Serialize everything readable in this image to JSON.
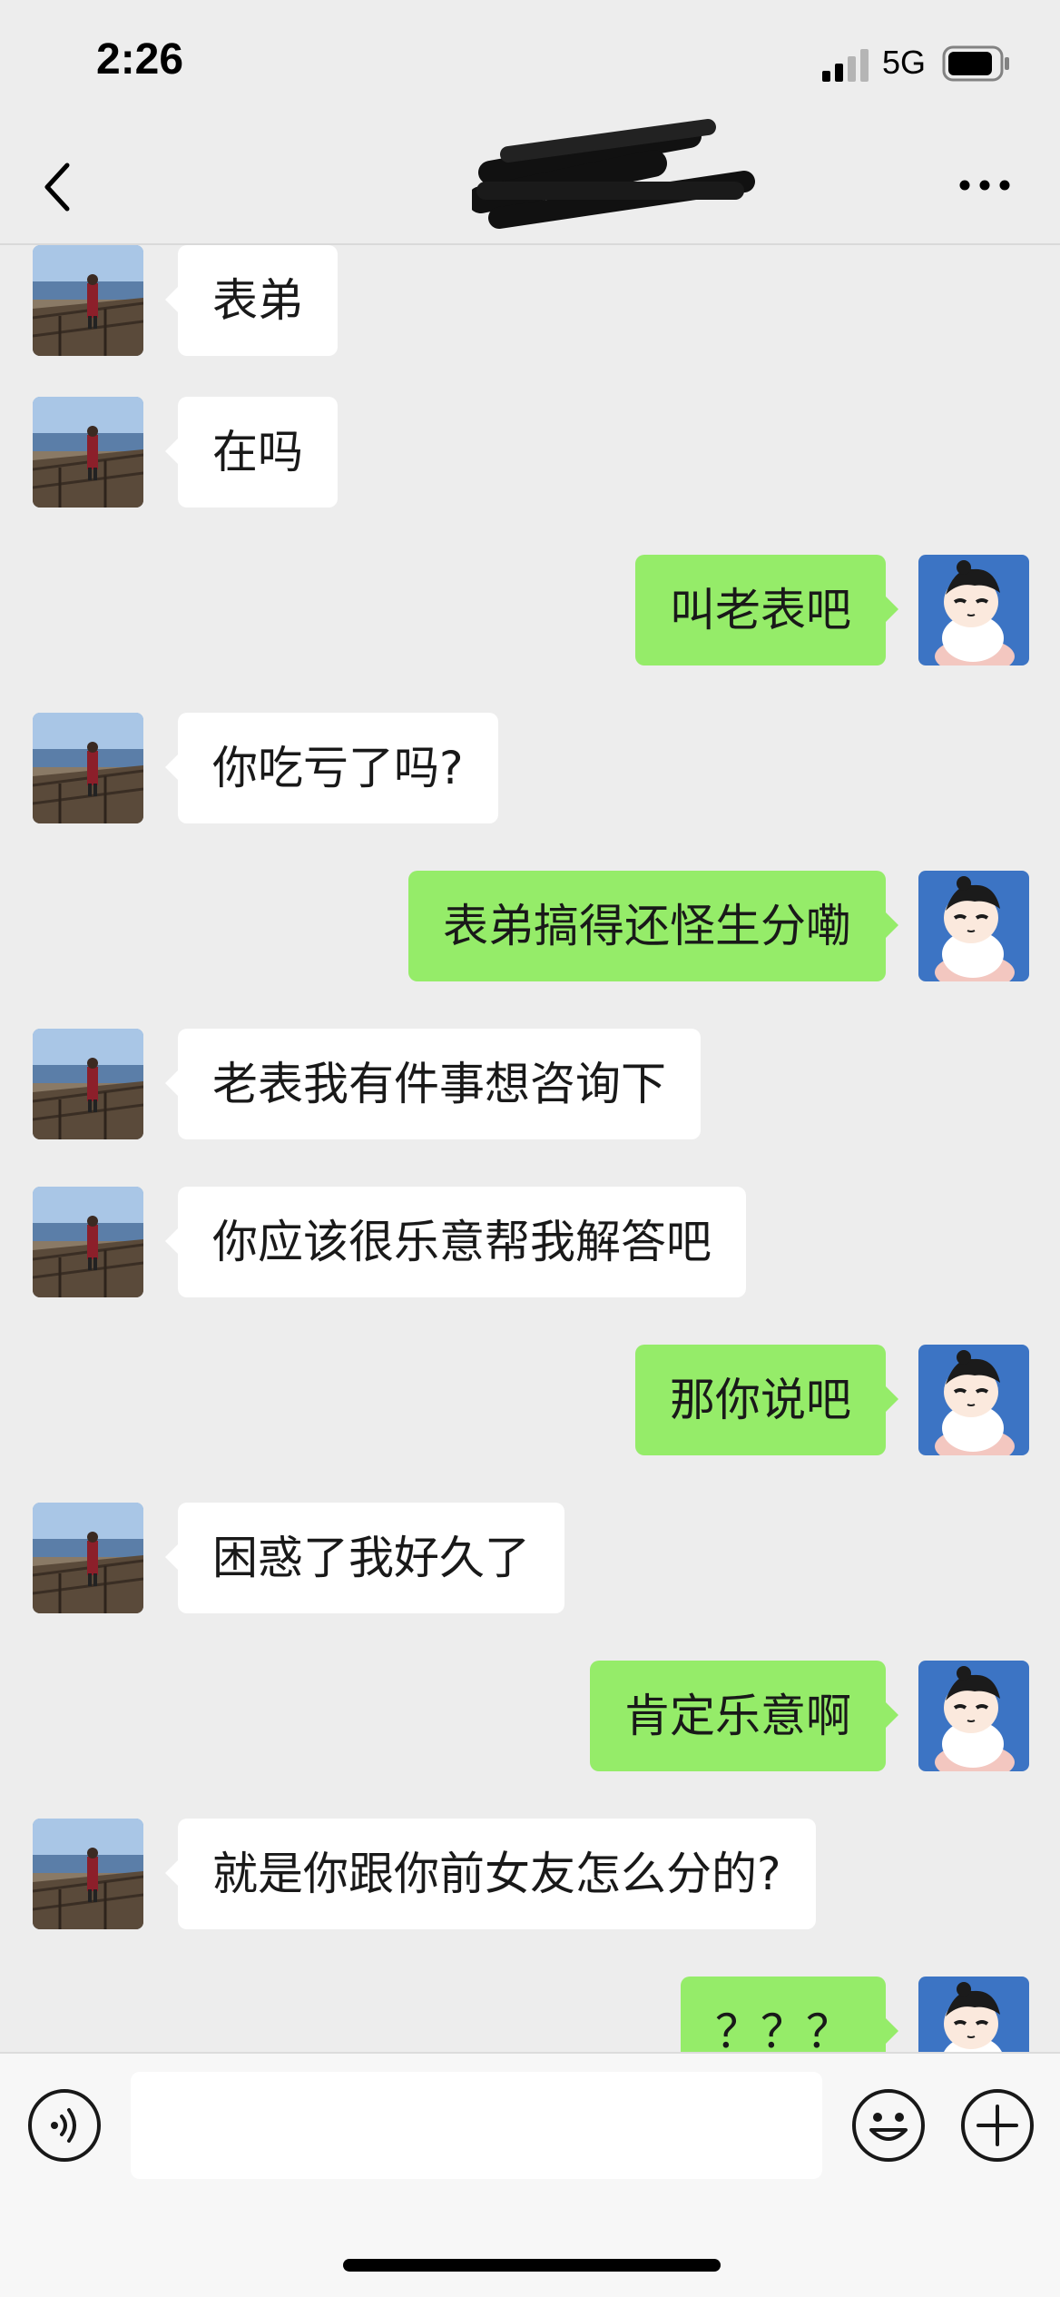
{
  "status_bar": {
    "time": "2:26",
    "network": "5G"
  },
  "nav": {
    "title_redacted": true
  },
  "messages": [
    {
      "side": "left",
      "text": "表弟"
    },
    {
      "side": "left",
      "text": "在吗"
    },
    {
      "side": "right",
      "text": "叫老表吧"
    },
    {
      "side": "left",
      "text": "你吃亏了吗?"
    },
    {
      "side": "right",
      "text": "表弟搞得还怪生分嘞"
    },
    {
      "side": "left",
      "text": "老表我有件事想咨询下"
    },
    {
      "side": "left",
      "text": "你应该很乐意帮我解答吧"
    },
    {
      "side": "right",
      "text": "那你说吧"
    },
    {
      "side": "left",
      "text": "困惑了我好久了"
    },
    {
      "side": "right",
      "text": "肯定乐意啊"
    },
    {
      "side": "left",
      "text": "就是你跟你前女友怎么分的?"
    },
    {
      "side": "right",
      "text": "？？？"
    }
  ],
  "input_bar": {
    "value": "",
    "placeholder": ""
  },
  "icons": {
    "back": "chevron-left-icon",
    "more": "more-dots-icon",
    "voice": "voice-icon",
    "emoji": "emoji-icon",
    "plus": "plus-icon"
  },
  "colors": {
    "background": "#ededed",
    "bubble_sent": "#95ec69",
    "bubble_received": "#ffffff"
  }
}
